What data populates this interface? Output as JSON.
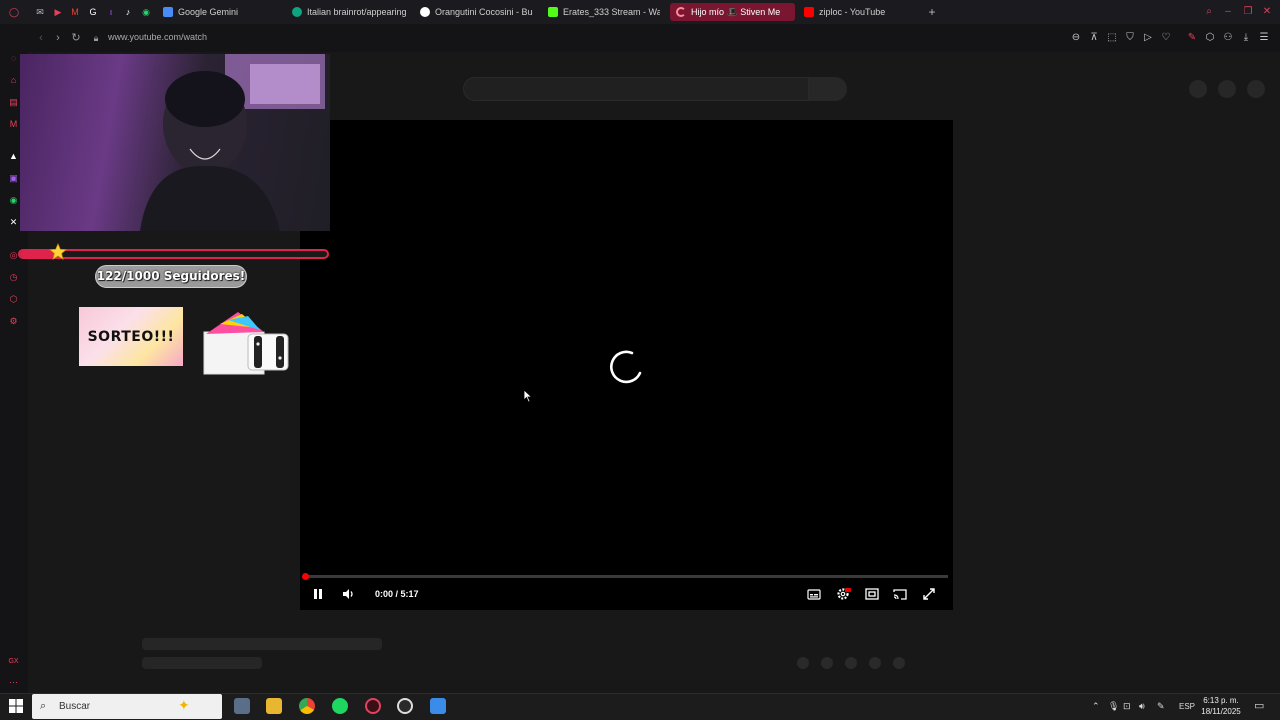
{
  "browser": {
    "tabs": [
      {
        "label": "Google Gemini",
        "icon": "gemini-icon",
        "color": "#4a8cf7"
      },
      {
        "label": "Italian brainrot/appearing",
        "icon": "chatgpt-icon",
        "color": "#10a37f"
      },
      {
        "label": "Orangutini Cocosini - Bus",
        "icon": "google-icon",
        "color": "#ffffff"
      },
      {
        "label": "Erates_333 Stream - Wat",
        "icon": "kick-icon",
        "color": "#53fc18"
      },
      {
        "label": "Hijo mío 🎩 Stiven Me",
        "icon": "loading-icon",
        "color": "#ff3b5c",
        "active": true
      },
      {
        "label": "ziploc - YouTube",
        "icon": "youtube-icon",
        "color": "#ff0000"
      }
    ],
    "new_tab": "+",
    "url": "www.youtube.com/watch"
  },
  "player": {
    "time": "0:00 / 5:17",
    "progress": 0.0,
    "state": "loading"
  },
  "overlay": {
    "goal_label": "122/1000 Seguidores!",
    "goal_progress": 0.122,
    "sorteo_text": "SORTEO!!!"
  },
  "taskbar": {
    "search_placeholder": "Buscar",
    "language": "ESP",
    "time": "6:13 p. m.",
    "date": "18/11/2025"
  }
}
